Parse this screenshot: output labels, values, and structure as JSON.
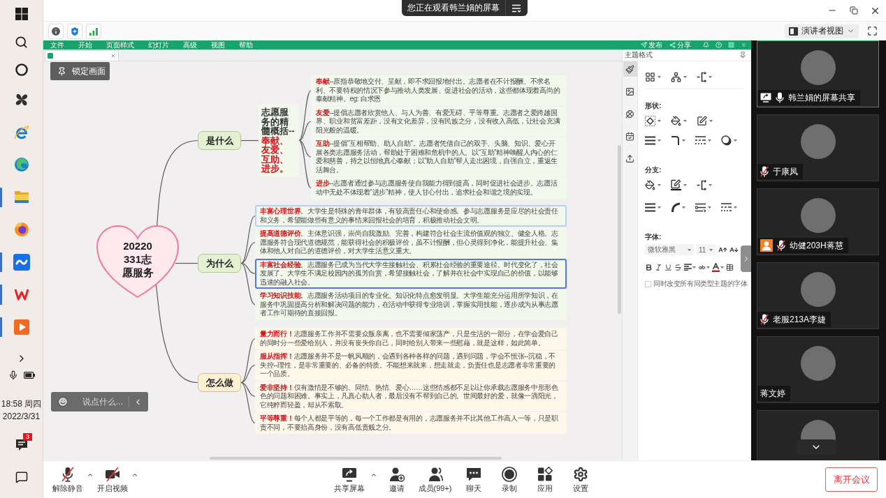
{
  "taskbar": {
    "items": [
      {
        "kind": "start",
        "running": false
      },
      {
        "kind": "search",
        "running": false
      },
      {
        "kind": "assistant",
        "running": false
      },
      {
        "kind": "pinwheel",
        "running": false
      },
      {
        "kind": "browser_e",
        "running": false
      },
      {
        "kind": "browser_wave",
        "running": false
      },
      {
        "kind": "folder",
        "running": true
      },
      {
        "kind": "browser_fox",
        "running": false
      },
      {
        "kind": "meeting",
        "running": true
      },
      {
        "kind": "zigzag",
        "running": true
      },
      {
        "kind": "player",
        "running": true
      }
    ],
    "clock": {
      "time": "18:58 周四",
      "date": "2022/3/31"
    },
    "notifications": "3"
  },
  "topbar": {
    "notice": "您正在观看韩兰娟的屏幕"
  },
  "toolbar": {
    "view_label": "演讲者视图"
  },
  "editor": {
    "menu": [
      "文件",
      "开始",
      "页面样式",
      "幻灯片",
      "高级",
      "视图",
      "帮助"
    ],
    "actions": [
      {
        "kind": "publish",
        "label": "发布"
      },
      {
        "kind": "share",
        "label": "分享"
      }
    ],
    "lock_label": "锁定画面",
    "panel": {
      "title": "主题格式",
      "tabs": [
        {
          "kind": "style",
          "selected": true
        },
        {
          "kind": "image",
          "selected": false
        },
        {
          "kind": "clover",
          "selected": false
        },
        {
          "kind": "task",
          "selected": false
        },
        {
          "kind": "export",
          "selected": false
        }
      ],
      "sections": [
        "形状:",
        "分支:",
        "字体:"
      ],
      "font": "微软雅黑",
      "size": "11",
      "sync_fonts": {
        "label": "同时改变所有同类型主题的字体",
        "checked": false
      }
    },
    "mindmap": {
      "central": "20220331志愿服务",
      "branches": [
        {
          "title": "是什么",
          "color": "#e3f0d2",
          "summary": {
            "lead": "志愿服务的精髓概括--",
            "keywords": "奉献、友爱、互助、进步。"
          },
          "details": [
            {
              "text": "**奉献**--原指恭敬地交付、呈献，即不求回报地付出。志愿者在不计报酬、不求名利、不要特权的情况下参与推动人类发展、促进社会的活动，这些都体现着高尚的奉献精神。eg: 白求恩",
              "selected": false,
              "hovered": false
            },
            {
              "text": "**友爱**--提倡志愿者欣赏他人、与人为善、有爱无碍、平等尊重。志愿者之爱跨越国界、职业和贫富差距，没有文化差异，没有民族之分，没有收入高低，让社会充满阳光般的温暖。",
              "selected": false,
              "hovered": false
            },
            {
              "text": "**互助**--提倡\"互相帮助、助人自助\"。志愿者凭借自己的双手、头脑、知识、爱心开展各类志愿服务活动，帮助处于困难和危机中的人。以“互助”精神唤醒人内心的仁爱和慈善，持之以恒地真心奉献；以\"助人自助\"帮人走出困境，自强自立，重返生活舞台。",
              "selected": false,
              "hovered": false
            },
            {
              "text": "**进步**--志愿者通过参与志愿服务使自我能力得到提高，同时促进社会进步。志愿活动中无处不体现着“进步”精神，使人甘心付出，追求社会和谐之境的实现。",
              "selected": false,
              "hovered": false
            }
          ]
        },
        {
          "title": "为什么",
          "color": "#e3f0d2",
          "details": [
            {
              "text": "**丰富心理世界**。大学生是特殊的青年群体，有较高责任心和使命感。参与志愿服务是应尽的社会责任和义务，希望能做些有意义的事情来回报社会的培育，积极推动社会文明。",
              "selected": false,
              "hovered": true
            },
            {
              "text": "**提高道德评价**。主体意识强，崇尚自我激励、完善，构建符合社会主流价值观的独立、健全人格。志愿服务符合现代道德规范，能获得社会的积极评价，虽不计报酬，但心灵得到净化，能提升社会、集体和他人对自己的道德评价，对大学生活意义重大。",
              "selected": false,
              "hovered": false
            },
            {
              "text": "**丰富社会经验**。志愿服务已成为当代大学生接触社会、积累社会经验的重要途径。时代变化了，社会发展了。大学生不满足校园内的孤芳自赏，希望接触社会，了解并在社会中实现自己的价值，以能够迅速的融入社会。",
              "selected": true,
              "hovered": false
            },
            {
              "text": "**学习知识技能**。志愿服务活动项目的专业化、知识化特点愈发明显。大学生能充分运用所学知识，在服务中巩固提高分析和解决问题的能力，在活动中获得专业培训，掌握实用技能，逐步成为从事志愿者工作可期待的直接回报。",
              "selected": false,
              "hovered": false
            }
          ]
        },
        {
          "title": "怎么做",
          "color": "#fcf0d0",
          "details": [
            {
              "text": "**量力而行！**志愿服务工作并不需要众叛亲离，也不需要倾家荡产，只是生活的一部分，在学会爱自己的同时分一些爱给别人，并没有丧失你自己，同时给别人带来一些慰藉，就是这样，如此简单。",
              "selected": false,
              "hovered": false
            },
            {
              "text": "**服从指挥！**志愿服务并不是一帆风顺的，会遇到各种各样的问题，遇到问题，学会不慌张--沉稳，不失控--理性，是非常重要的、必备的特质。不能想来就来，想走就走，负责任也是志愿者非常重要的一个品质。",
              "selected": false,
              "hovered": false
            },
            {
              "text": "**爱非坚持！**仅有激情是不够的。同情、热情、爱心……这些情感都不足以让你承载志愿服务中形形色色的问题和困难。事实上，凡真心助人者，最后没有不帮到自己的。世间最好的爱，就像一滴阳光，它纯粹而轻盈，却从不索取。",
              "selected": false,
              "hovered": false
            },
            {
              "text": "**平等尊重！**每个人都是平等的，每一个工作都是有用的，志愿服务并不比其他工作高人一等，只是职责不同，不要抬高身份，没有高低贵贱之分。",
              "selected": false,
              "hovered": false
            }
          ]
        }
      ]
    }
  },
  "chat": {
    "placeholder": "说点什么..."
  },
  "participants": [
    {
      "name": "韩兰娟的屏幕共享",
      "active": true,
      "sharing": true,
      "badge": false,
      "mic": true,
      "muted": false
    },
    {
      "name": "于康凤",
      "active": false,
      "sharing": false,
      "badge": false,
      "mic": true,
      "muted": true
    },
    {
      "name": "幼健203H蒋慧",
      "active": false,
      "sharing": false,
      "badge": true,
      "mic": true,
      "muted": true
    },
    {
      "name": "老服213A李婕",
      "active": false,
      "sharing": false,
      "badge": false,
      "mic": true,
      "muted": true
    },
    {
      "name": "蒋文婷",
      "active": false,
      "sharing": false,
      "badge": false,
      "mic": false,
      "muted": false
    },
    {
      "active": false,
      "sharing": false,
      "badge": false,
      "mic": false,
      "muted": false
    }
  ],
  "bottombar": {
    "left": [
      {
        "kind": "mic",
        "label": "解除静音",
        "off": true,
        "menu": true
      },
      {
        "kind": "video",
        "label": "开启视频",
        "off": true,
        "menu": true
      }
    ],
    "center": [
      {
        "kind": "share",
        "label": "共享屏幕",
        "menu": true
      },
      {
        "kind": "invite",
        "label": "邀请",
        "menu": false
      },
      {
        "kind": "members",
        "label": "成员(99+)",
        "menu": false
      },
      {
        "kind": "chat",
        "label": "聊天",
        "menu": false
      },
      {
        "kind": "record",
        "label": "录制",
        "menu": false
      },
      {
        "kind": "apps",
        "label": "应用",
        "menu": false
      },
      {
        "kind": "settings",
        "label": "设置",
        "menu": false
      }
    ],
    "leave": "离开会议"
  }
}
